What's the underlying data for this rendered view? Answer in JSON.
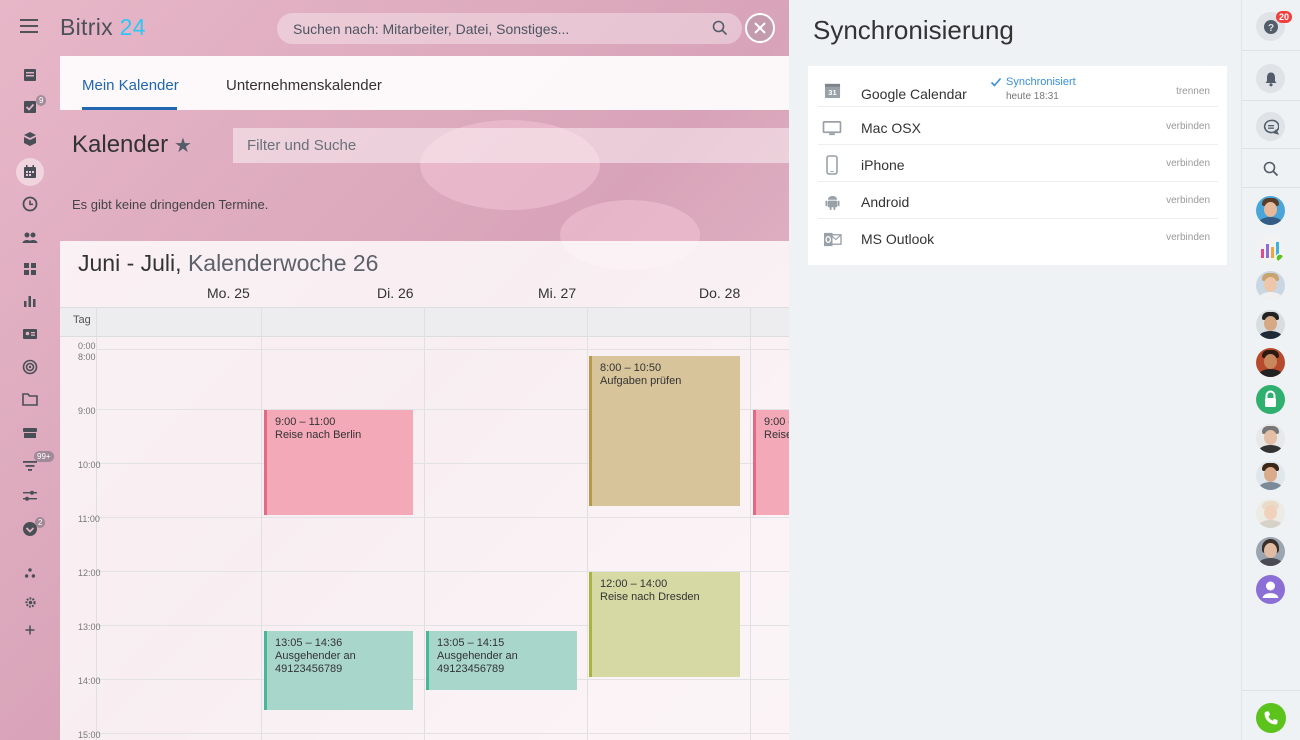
{
  "header": {
    "logo_main": "Bitrix",
    "logo_num": "24",
    "search_placeholder": "Suchen nach: Mitarbeiter, Datei, Sonstiges..."
  },
  "leftnav": {
    "badges": {
      "tasks": "9",
      "filter": "99+",
      "approve": "2"
    },
    "icons": [
      "feed-icon",
      "tasks-icon",
      "crm-icon",
      "calendar-icon",
      "time-icon",
      "group-icon",
      "apps-icon",
      "chart-icon",
      "contacts-icon",
      "target-icon",
      "drive-icon",
      "store-icon",
      "filter-icon",
      "sliders-icon",
      "approve-icon",
      "structure-icon",
      "settings-icon",
      "add-icon"
    ]
  },
  "tabs": [
    {
      "label": "Mein Kalender",
      "active": true
    },
    {
      "label": "Unternehmenskalender",
      "active": false
    }
  ],
  "calendar": {
    "title": "Kalender",
    "filter_placeholder": "Filter und Suche",
    "no_events": "Es gibt keine dringenden Termine.",
    "week_title": "Juni - Juli,",
    "week_number": "Kalenderwoche 26",
    "days": [
      "Mo. 25",
      "Di. 26",
      "Mi. 27",
      "Do. 28"
    ],
    "allday_label": "Tag",
    "times": [
      "0:00",
      "8:00",
      "9:00",
      "10:00",
      "11:00",
      "12:00",
      "13:00",
      "14:00",
      "15:00"
    ],
    "events": [
      {
        "time": "9:00 – 11:00",
        "title": "Reise nach Berlin",
        "color": "red"
      },
      {
        "time": "8:00 – 10:50",
        "title": "Aufgaben prüfen",
        "color": "brown"
      },
      {
        "time": "9:00 –",
        "title": "Reise",
        "color": "red"
      },
      {
        "time": "12:00 – 14:00",
        "title": "Reise nach Dresden",
        "color": "olive"
      },
      {
        "time": "13:05 – 14:36",
        "title": "Ausgehender an 49123456789",
        "color": "teal"
      },
      {
        "time": "13:05 – 14:15",
        "title": "Ausgehender an 49123456789",
        "color": "teal"
      }
    ]
  },
  "sync": {
    "title": "Synchronisierung",
    "rows": [
      {
        "name": "Google Calendar",
        "icon": "google-calendar-icon",
        "action": "trennen",
        "status": "Synchronisiert",
        "status_time": "heute 18:31"
      },
      {
        "name": "Mac OSX",
        "icon": "monitor-icon",
        "action": "verbinden"
      },
      {
        "name": "iPhone",
        "icon": "iphone-icon",
        "action": "verbinden"
      },
      {
        "name": "Android",
        "icon": "android-icon",
        "action": "verbinden"
      },
      {
        "name": "MS Outlook",
        "icon": "outlook-icon",
        "action": "verbinden"
      }
    ]
  },
  "rightbar": {
    "help_badge": "20",
    "buttons": [
      "help-icon",
      "bell-icon",
      "chat-icon",
      "search-icon"
    ],
    "colors": {
      "accent": "#2067b0",
      "phone": "#5cc21c",
      "lock": "#2fb06f",
      "user": "#8b6fd6"
    }
  }
}
